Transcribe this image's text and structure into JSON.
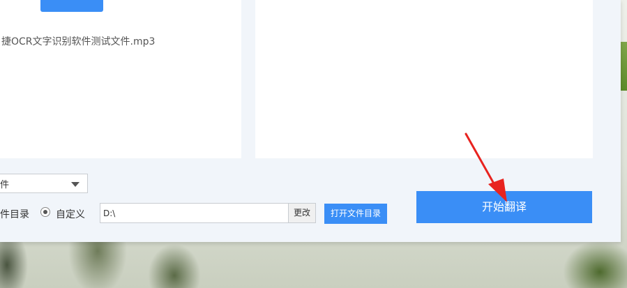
{
  "colors": {
    "accent": "#3a8ef6",
    "arrow": "#e8231f"
  },
  "source": {
    "file_name": "捷OCR文字识别软件测试文件.mp3"
  },
  "output": {
    "format_select_value": "件",
    "option_source_label": "件目录",
    "option_custom_label": "自定义",
    "path_value": "D:\\",
    "change_label": "更改",
    "open_dir_label": "打开文件目录"
  },
  "actions": {
    "start_label": "开始翻译"
  },
  "annotation": {
    "icon": "red-arrow-icon"
  }
}
